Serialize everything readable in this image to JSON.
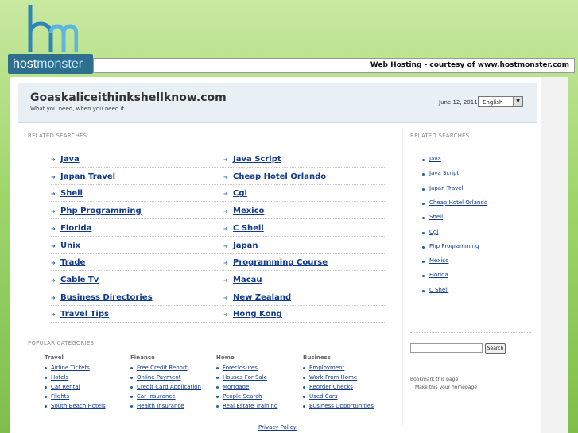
{
  "header": {
    "logo_host": "host",
    "logo_monster": "monster",
    "topbar_text": "Web Hosting - courtesy of www.hostmonster.com"
  },
  "site": {
    "title": "Goaskaliceithinkshellknow.com",
    "subtitle": "What you need, when you need it",
    "date": "June 12, 2011",
    "language": "English"
  },
  "related": {
    "label": "RELATED SEARCHES",
    "left": [
      "Java",
      "Japan Travel",
      "Shell",
      "Php Programming",
      "Florida",
      "Unix",
      "Trade",
      "Cable Tv",
      "Business Directories",
      "Travel Tips"
    ],
    "right": [
      "Java Script",
      "Cheap Hotel Orlando",
      "Cgi",
      "Mexico",
      "C Shell",
      "Japan",
      "Programming Course",
      "Macau",
      "New Zealand",
      "Hong Kong"
    ]
  },
  "sidebar": {
    "label": "RELATED SEARCHES",
    "items": [
      "Java",
      "Java Script",
      "Japan Travel",
      "Cheap Hotel Orlando",
      "Shell",
      "Cgi",
      "Php Programming",
      "Mexico",
      "Florida",
      "C Shell"
    ],
    "search_button": "Search",
    "bookmark": "Bookmark this page",
    "homepage": "Make this your homepage"
  },
  "popular": {
    "label": "POPULAR CATEGORIES",
    "columns": [
      {
        "head": "Travel",
        "items": [
          "Airline Tickets",
          "Hotels",
          "Car Rental",
          "Flights",
          "South Beach Hotels"
        ]
      },
      {
        "head": "Finance",
        "items": [
          "Free Credit Report",
          "Online Payment",
          "Credit Card Application",
          "Car Insurance",
          "Health Insurance"
        ]
      },
      {
        "head": "Home",
        "items": [
          "Foreclosures",
          "Houses For Sale",
          "Mortgage",
          "People Search",
          "Real Estate Training"
        ]
      },
      {
        "head": "Business",
        "items": [
          "Employment",
          "Work From Home",
          "Reorder Checks",
          "Used Cars",
          "Business Opportunities"
        ]
      }
    ]
  },
  "footer": {
    "privacy": "Privacy Policy"
  }
}
